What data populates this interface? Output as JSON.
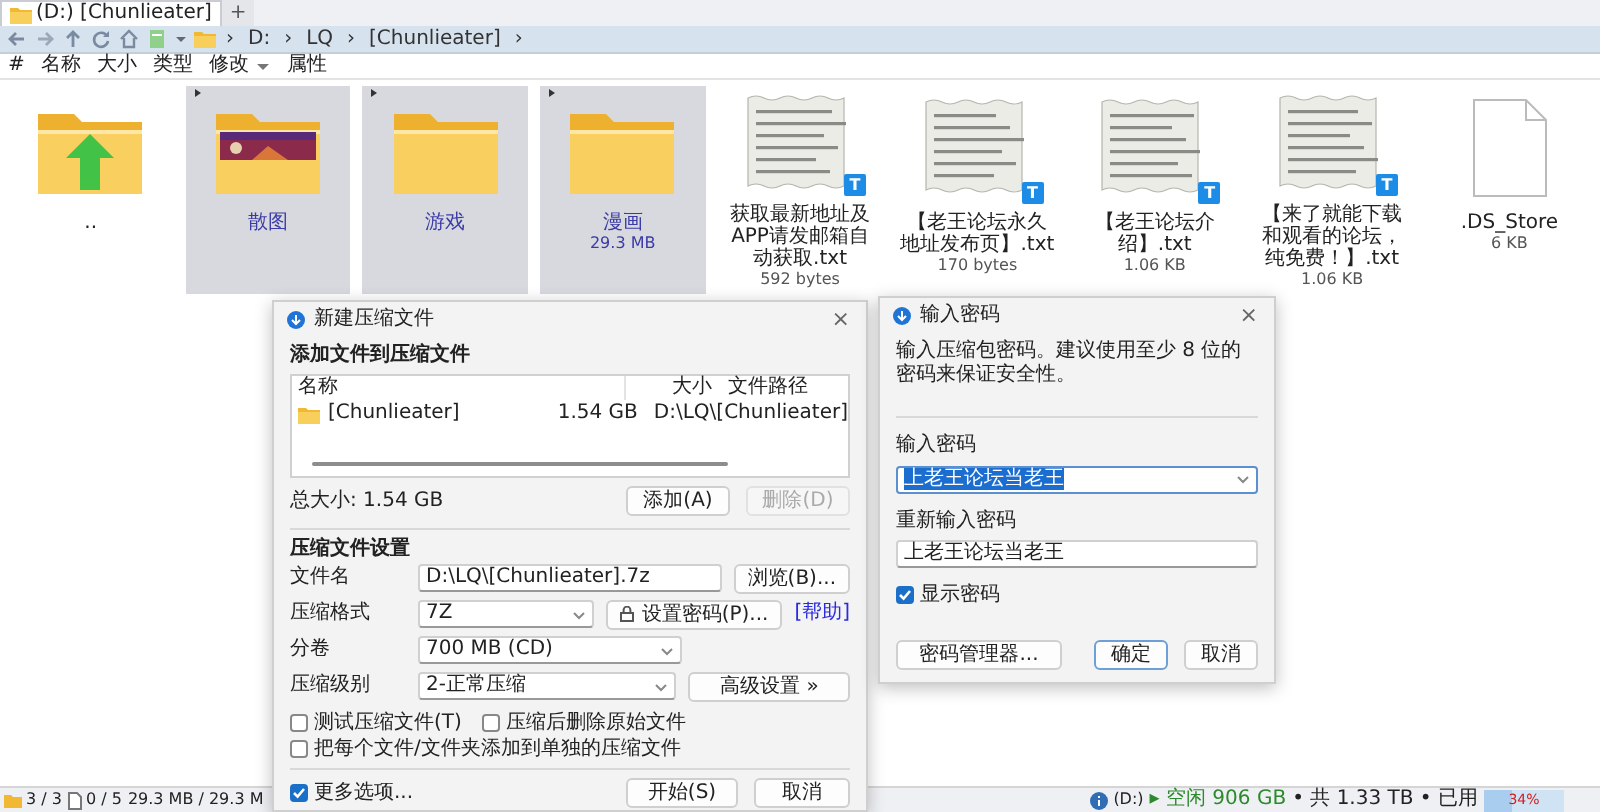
{
  "tabs": [
    {
      "label": "(D:) [Chunlieater]",
      "selected": true
    }
  ],
  "new_tab": "+",
  "breadcrumb": {
    "separator": "›",
    "parts": [
      "D:",
      "LQ",
      "[Chunlieater]"
    ]
  },
  "columns": [
    {
      "label": "#",
      "sorted": false
    },
    {
      "label": "名称",
      "sorted": false
    },
    {
      "label": "大小",
      "sorted": false
    },
    {
      "label": "类型",
      "sorted": false
    },
    {
      "label": "修改",
      "sorted": true
    },
    {
      "label": "属性",
      "sorted": false
    }
  ],
  "files": [
    {
      "kind": "parent",
      "name": "..",
      "selected": false
    },
    {
      "kind": "folder",
      "name": "散图",
      "preview": true,
      "selected": true
    },
    {
      "kind": "folder",
      "name": "游戏",
      "preview": false,
      "selected": true
    },
    {
      "kind": "folder",
      "name": "漫画",
      "size": "29.3 MB",
      "preview": false,
      "selected": true
    },
    {
      "kind": "txt",
      "name": "获取最新地址及APP请发邮箱自动获取.txt",
      "size": "592 bytes",
      "badge": "T",
      "selected": false
    },
    {
      "kind": "txt",
      "name": "【老王论坛永久地址发布页】.txt",
      "size": "170 bytes",
      "badge": "T",
      "selected": false
    },
    {
      "kind": "txt",
      "name": "【老王论坛介绍】.txt",
      "size": "1.06 KB",
      "badge": "T",
      "selected": false
    },
    {
      "kind": "txt",
      "name": "【来了就能下载和观看的论坛，纯免费！】.txt",
      "size": "1.06 KB",
      "badge": "T",
      "selected": false
    },
    {
      "kind": "file",
      "name": ".DS_Store",
      "size": "6 KB",
      "selected": false
    }
  ],
  "compress_dialog": {
    "title": "新建压缩文件",
    "close": "×",
    "section_add": "添加文件到压缩文件",
    "list_columns": [
      "名称",
      "大小",
      "文件路径"
    ],
    "list_rows": [
      {
        "name": "[Chunlieater]",
        "size": "1.54 GB",
        "path": "D:\\LQ\\[Chunlieater]"
      }
    ],
    "total": "总大小: 1.54 GB",
    "add_button": {
      "label": "添加(A)",
      "disabled": false
    },
    "remove_button": {
      "label": "删除(D)",
      "disabled": true
    },
    "section_settings": "压缩文件设置",
    "fields": [
      {
        "kind": "text",
        "label": "文件名",
        "value": "D:\\LQ\\[Chunlieater].7z"
      },
      {
        "kind": "combo",
        "label": "压缩格式",
        "value": "7Z"
      },
      {
        "kind": "combo",
        "label": "分卷",
        "value": "700 MB (CD)"
      },
      {
        "kind": "combo",
        "label": "压缩级别",
        "value": "2-正常压缩"
      }
    ],
    "browse": "浏览(B)...",
    "set_password": "设置密码(P)...",
    "help": "[帮助]",
    "advanced": "高级设置 »",
    "options": [
      {
        "label": "测试压缩文件(T)",
        "checked": false
      },
      {
        "label": "压缩后删除原始文件",
        "checked": false
      },
      {
        "label": "把每个文件/文件夹添加到单独的压缩文件",
        "checked": false
      }
    ],
    "more_options": {
      "label": "更多选项...",
      "checked": true
    },
    "start": "开始(S)",
    "cancel": "取消"
  },
  "password_dialog": {
    "title": "输入密码",
    "close": "×",
    "description": "输入压缩包密码。建议使用至少 8 位的密码来保证安全性。",
    "password_label": "输入密码",
    "password": {
      "value": "上老王论坛当老王",
      "selected": true
    },
    "confirm_label": "重新输入密码",
    "confirm_value": "上老王论坛当老王",
    "show_password": {
      "label": "显示密码",
      "checked": true
    },
    "buttons": [
      {
        "label": "密码管理器...",
        "default": false
      },
      {
        "label": "确定",
        "default": true
      },
      {
        "label": "取消",
        "default": false
      }
    ]
  },
  "status_bar": {
    "selection": "3 / 3",
    "files": "0 / 5",
    "size": "29.3 MB / 29.3 M",
    "drive": "(D:)",
    "free": "▸ 空闲 906 GB",
    "total": "• 共 1.33 TB • 已用",
    "usage": {
      "level": 0.34,
      "reading": "34%"
    }
  }
}
